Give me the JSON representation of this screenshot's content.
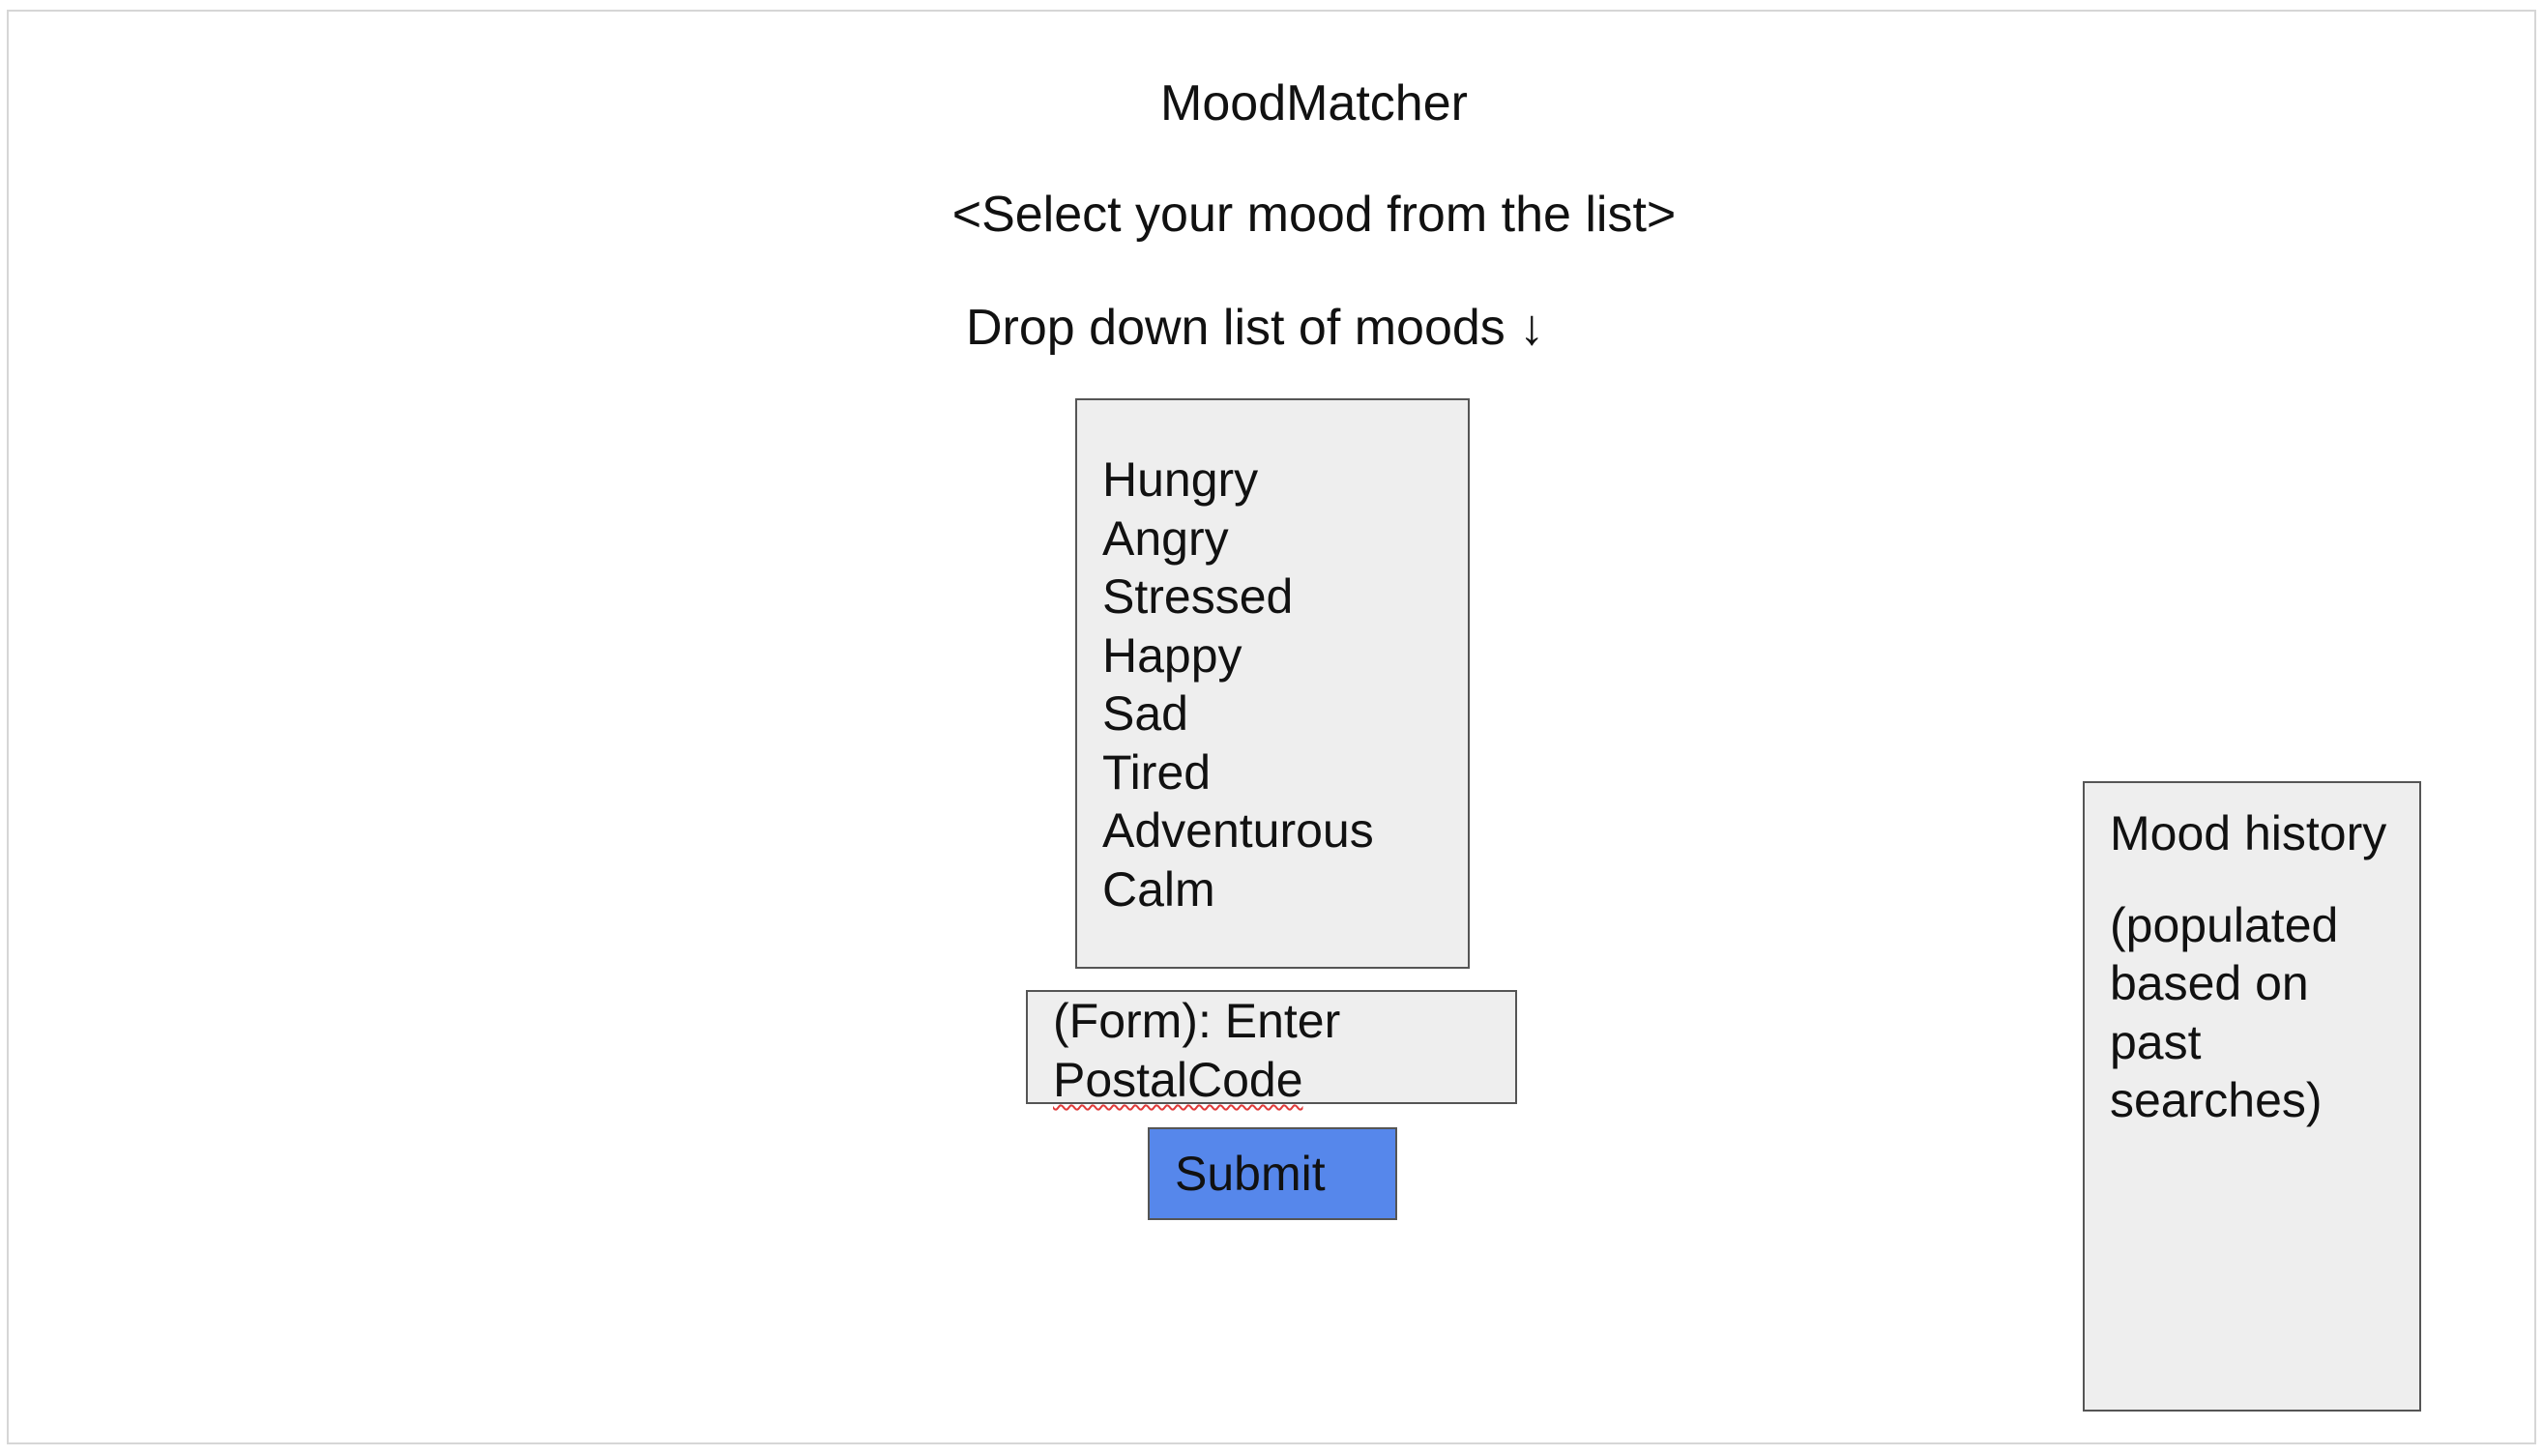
{
  "app": {
    "title": "MoodMatcher",
    "instruction": "<Select your mood from the list>",
    "dropdown_caption": "Drop down list of moods ↓"
  },
  "mood_list": {
    "items": [
      "Hungry",
      "Angry",
      "Stressed",
      "Happy",
      "Sad",
      "Tired",
      "Adventurous",
      "Calm"
    ]
  },
  "postal_form": {
    "line1": "(Form): Enter",
    "line2": "PostalCode"
  },
  "submit": {
    "label": "Submit",
    "color": "#5687eb"
  },
  "history": {
    "title": "Mood history",
    "note_lines": [
      "(populated",
      "based on",
      "past",
      "searches)"
    ]
  }
}
